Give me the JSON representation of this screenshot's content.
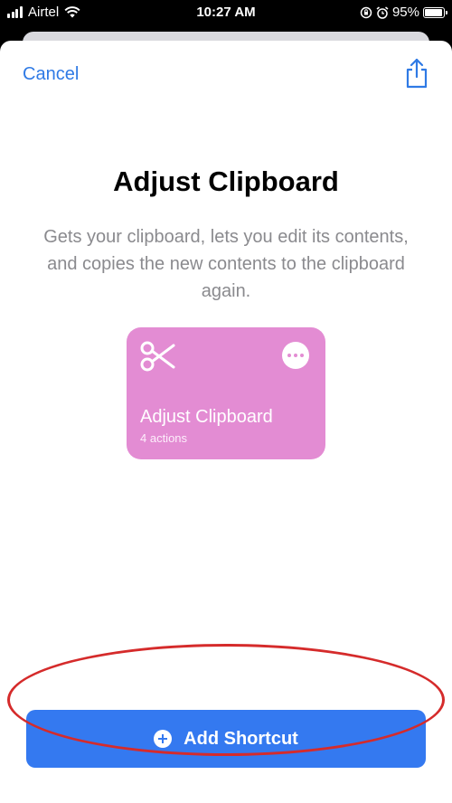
{
  "status_bar": {
    "carrier": "Airtel",
    "time": "10:27 AM",
    "battery": "95%",
    "battery_level": 0.95,
    "icons": [
      "signal-icon",
      "wifi-icon",
      "lock-rotation-icon",
      "alarm-icon",
      "battery-icon"
    ]
  },
  "nav": {
    "cancel_label": "Cancel",
    "share_icon": "share-icon"
  },
  "shortcut": {
    "title": "Adjust Clipboard",
    "description": "Gets your clipboard, lets you edit its contents, and copies the new contents to the clipboard again.",
    "card": {
      "name": "Adjust Clipboard",
      "subtitle": "4 actions",
      "icon": "scissors-icon",
      "color": "#e38cd3"
    }
  },
  "actions": {
    "add_label": "Add Shortcut",
    "add_icon": "plus-circle-icon"
  },
  "colors": {
    "accent": "#2f7ae5",
    "button": "#3479f0",
    "highlight": "#d52b2b"
  }
}
